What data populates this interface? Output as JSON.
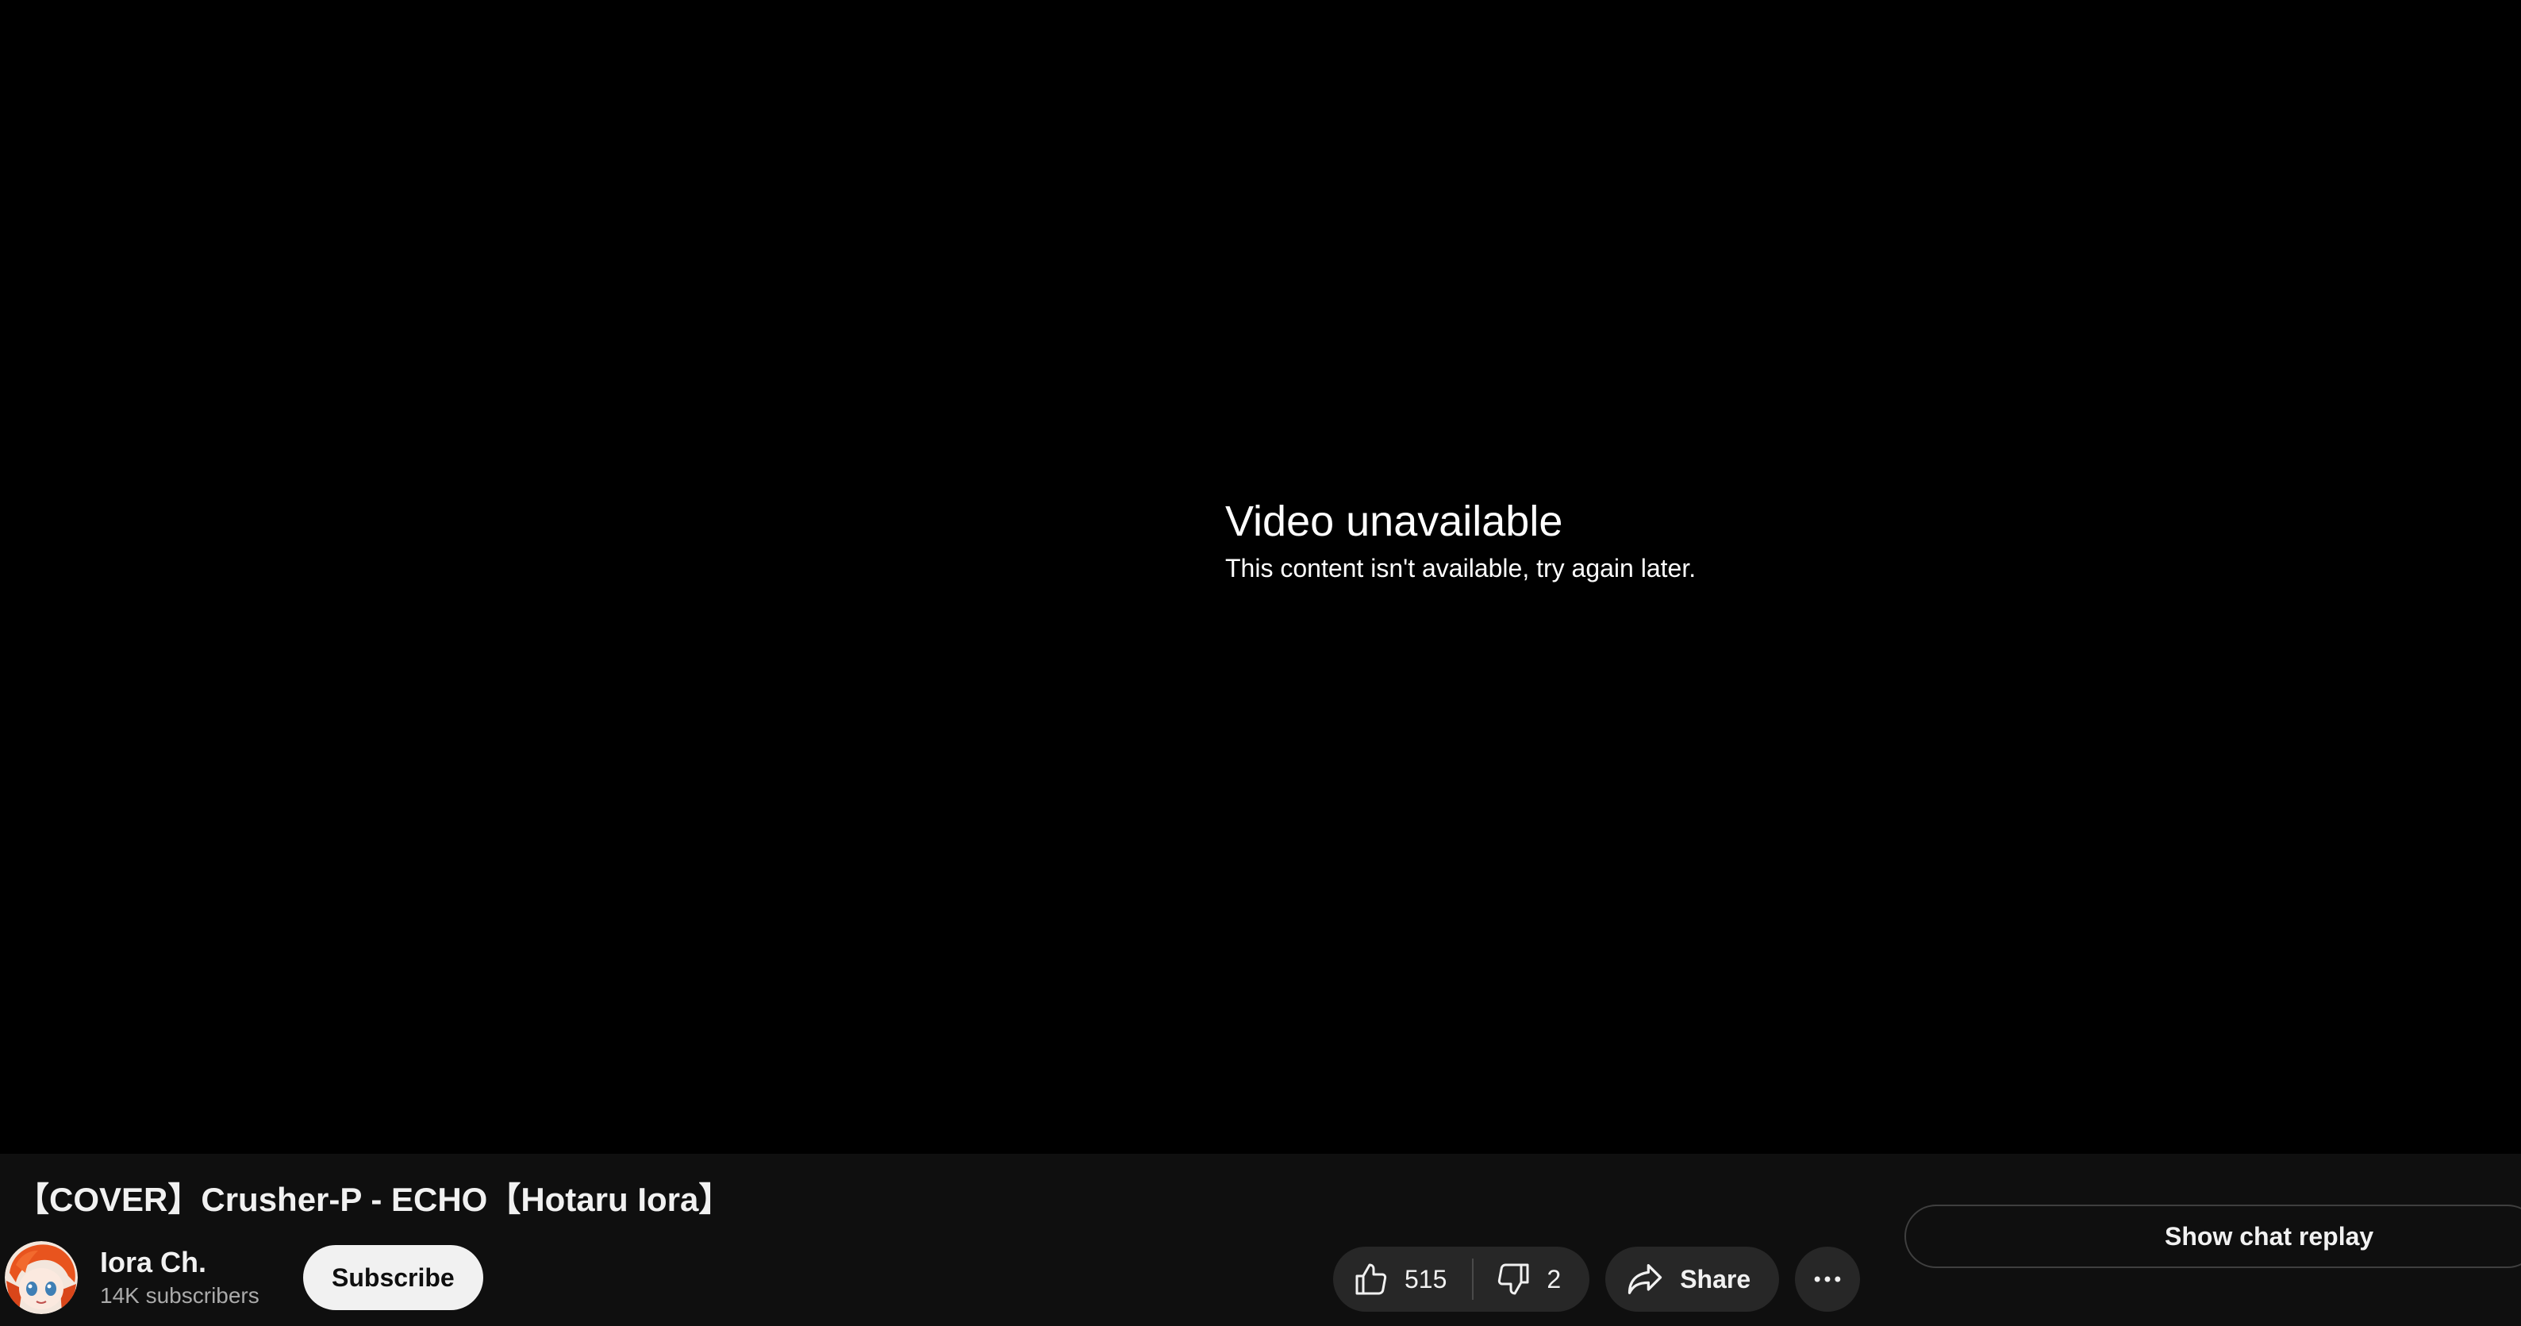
{
  "player": {
    "error_title": "Video unavailable",
    "error_message": "This content isn't available, try again later."
  },
  "video": {
    "title": "【COVER】Crusher-P - ECHO【Hotaru Iora】"
  },
  "channel": {
    "name": "Iora Ch.",
    "subscribers": "14K subscribers",
    "avatar_icon": "channel-avatar-icon"
  },
  "subscribe": {
    "label": "Subscribe"
  },
  "actions": {
    "like_count": "515",
    "like_icon": "thumbs-up-icon",
    "dislike_count": "2",
    "dislike_icon": "thumbs-down-icon",
    "share_label": "Share",
    "share_icon": "share-arrow-icon",
    "more_icon": "more-horizontal-icon"
  },
  "chat": {
    "show_replay_label": "Show chat replay"
  },
  "colors": {
    "background": "#0f0f0f",
    "player": "#000000",
    "pill": "#272727",
    "subscribe_bg": "#f1f1f1",
    "text_secondary": "#aaaaaa"
  }
}
